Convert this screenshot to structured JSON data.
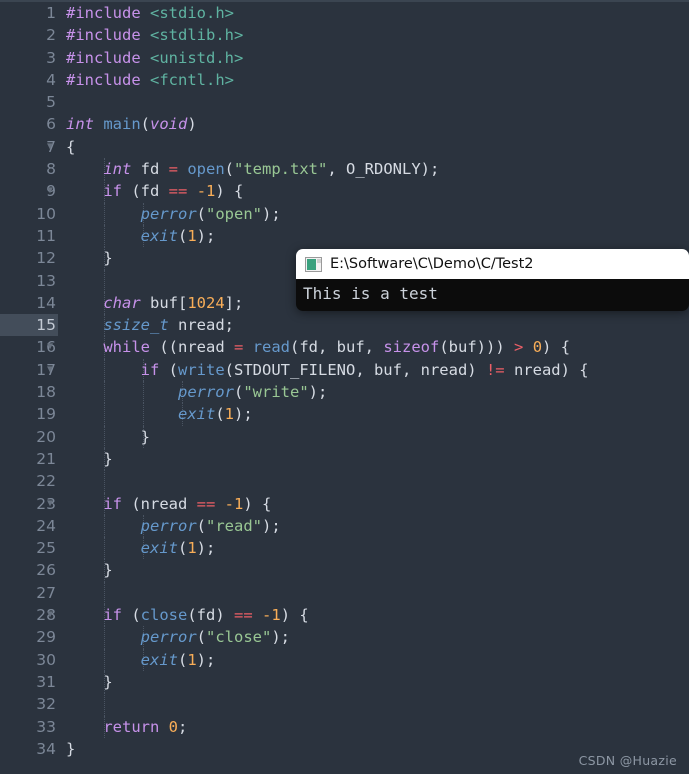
{
  "watermark": "CSDN @Huazie",
  "editor": {
    "language": "c",
    "current_line": 15,
    "colors": {
      "background": "#2b333e",
      "gutter_text": "#7c8797",
      "current_line_gutter": "#434d5a",
      "keyword": "#c792ea",
      "header": "#5fb3a1",
      "function": "#6699cc",
      "string": "#99c794",
      "number": "#f9ae58",
      "operator": "#ec5f67",
      "plain": "#d6dbe3"
    },
    "lines": [
      {
        "n": "1",
        "fold": false,
        "guides": [],
        "tokens": [
          {
            "t": "#include ",
            "c": "kw"
          },
          {
            "t": "<stdio.h>",
            "c": "hdr"
          }
        ]
      },
      {
        "n": "2",
        "fold": false,
        "guides": [],
        "tokens": [
          {
            "t": "#include ",
            "c": "kw"
          },
          {
            "t": "<stdlib.h>",
            "c": "hdr"
          }
        ]
      },
      {
        "n": "3",
        "fold": false,
        "guides": [],
        "tokens": [
          {
            "t": "#include ",
            "c": "kw"
          },
          {
            "t": "<unistd.h>",
            "c": "hdr"
          }
        ]
      },
      {
        "n": "4",
        "fold": false,
        "guides": [],
        "tokens": [
          {
            "t": "#include ",
            "c": "kw"
          },
          {
            "t": "<fcntl.h>",
            "c": "hdr"
          }
        ]
      },
      {
        "n": "5",
        "fold": false,
        "guides": [],
        "tokens": []
      },
      {
        "n": "6",
        "fold": false,
        "guides": [],
        "tokens": [
          {
            "t": "int",
            "c": "typ"
          },
          {
            "t": " ",
            "c": "pl"
          },
          {
            "t": "main",
            "c": "fn"
          },
          {
            "t": "(",
            "c": "pun"
          },
          {
            "t": "void",
            "c": "typ"
          },
          {
            "t": ")",
            "c": "pun"
          }
        ]
      },
      {
        "n": "7",
        "fold": true,
        "guides": [],
        "tokens": [
          {
            "t": "{",
            "c": "pun"
          }
        ]
      },
      {
        "n": "8",
        "fold": false,
        "guides": [
          "ig1"
        ],
        "tokens": [
          {
            "t": "    ",
            "c": "pl"
          },
          {
            "t": "int",
            "c": "typ"
          },
          {
            "t": " fd ",
            "c": "pl"
          },
          {
            "t": "=",
            "c": "op"
          },
          {
            "t": " ",
            "c": "pl"
          },
          {
            "t": "open",
            "c": "fn"
          },
          {
            "t": "(",
            "c": "pun"
          },
          {
            "t": "\"temp.txt\"",
            "c": "str"
          },
          {
            "t": ", O_RDONLY);",
            "c": "pun"
          }
        ]
      },
      {
        "n": "9",
        "fold": true,
        "guides": [
          "ig1"
        ],
        "tokens": [
          {
            "t": "    ",
            "c": "pl"
          },
          {
            "t": "if",
            "c": "kw"
          },
          {
            "t": " (fd ",
            "c": "pun"
          },
          {
            "t": "==",
            "c": "op"
          },
          {
            "t": " ",
            "c": "pl"
          },
          {
            "t": "-1",
            "c": "num2"
          },
          {
            "t": ") {",
            "c": "pun"
          }
        ]
      },
      {
        "n": "10",
        "fold": false,
        "guides": [
          "ig1",
          "ig2"
        ],
        "tokens": [
          {
            "t": "        ",
            "c": "pl"
          },
          {
            "t": "perror",
            "c": "fni"
          },
          {
            "t": "(",
            "c": "pun"
          },
          {
            "t": "\"open\"",
            "c": "str"
          },
          {
            "t": ");",
            "c": "pun"
          }
        ]
      },
      {
        "n": "11",
        "fold": false,
        "guides": [
          "ig1",
          "ig2"
        ],
        "tokens": [
          {
            "t": "        ",
            "c": "pl"
          },
          {
            "t": "exit",
            "c": "fni"
          },
          {
            "t": "(",
            "c": "pun"
          },
          {
            "t": "1",
            "c": "num2"
          },
          {
            "t": ");",
            "c": "pun"
          }
        ]
      },
      {
        "n": "12",
        "fold": false,
        "guides": [
          "ig1"
        ],
        "tokens": [
          {
            "t": "    }",
            "c": "pun"
          }
        ]
      },
      {
        "n": "13",
        "fold": false,
        "guides": [
          "ig1"
        ],
        "tokens": []
      },
      {
        "n": "14",
        "fold": false,
        "guides": [
          "ig1"
        ],
        "tokens": [
          {
            "t": "    ",
            "c": "pl"
          },
          {
            "t": "char",
            "c": "typ"
          },
          {
            "t": " buf[",
            "c": "pun"
          },
          {
            "t": "1024",
            "c": "num2"
          },
          {
            "t": "];",
            "c": "pun"
          }
        ]
      },
      {
        "n": "15",
        "fold": false,
        "guides": [
          "ig1"
        ],
        "tokens": [
          {
            "t": "    ",
            "c": "pl"
          },
          {
            "t": "ssize_t",
            "c": "typ2"
          },
          {
            "t": " nread;",
            "c": "pun"
          }
        ]
      },
      {
        "n": "16",
        "fold": true,
        "guides": [
          "ig1"
        ],
        "tokens": [
          {
            "t": "    ",
            "c": "pl"
          },
          {
            "t": "while",
            "c": "kw"
          },
          {
            "t": " ((nread ",
            "c": "pun"
          },
          {
            "t": "=",
            "c": "op"
          },
          {
            "t": " ",
            "c": "pl"
          },
          {
            "t": "read",
            "c": "fn"
          },
          {
            "t": "(fd, buf, ",
            "c": "pun"
          },
          {
            "t": "sizeof",
            "c": "kw"
          },
          {
            "t": "(buf))) ",
            "c": "pun"
          },
          {
            "t": ">",
            "c": "op"
          },
          {
            "t": " ",
            "c": "pl"
          },
          {
            "t": "0",
            "c": "num2"
          },
          {
            "t": ") {",
            "c": "pun"
          }
        ]
      },
      {
        "n": "17",
        "fold": true,
        "guides": [
          "ig1",
          "ig2"
        ],
        "tokens": [
          {
            "t": "        ",
            "c": "pl"
          },
          {
            "t": "if",
            "c": "kw"
          },
          {
            "t": " (",
            "c": "pun"
          },
          {
            "t": "write",
            "c": "fn"
          },
          {
            "t": "(STDOUT_FILENO, buf, nread) ",
            "c": "pun"
          },
          {
            "t": "!=",
            "c": "op"
          },
          {
            "t": " nread) {",
            "c": "pun"
          }
        ]
      },
      {
        "n": "18",
        "fold": false,
        "guides": [
          "ig1",
          "ig2",
          "ig3"
        ],
        "tokens": [
          {
            "t": "            ",
            "c": "pl"
          },
          {
            "t": "perror",
            "c": "fni"
          },
          {
            "t": "(",
            "c": "pun"
          },
          {
            "t": "\"write\"",
            "c": "str"
          },
          {
            "t": ");",
            "c": "pun"
          }
        ]
      },
      {
        "n": "19",
        "fold": false,
        "guides": [
          "ig1",
          "ig2",
          "ig3"
        ],
        "tokens": [
          {
            "t": "            ",
            "c": "pl"
          },
          {
            "t": "exit",
            "c": "fni"
          },
          {
            "t": "(",
            "c": "pun"
          },
          {
            "t": "1",
            "c": "num2"
          },
          {
            "t": ");",
            "c": "pun"
          }
        ]
      },
      {
        "n": "20",
        "fold": false,
        "guides": [
          "ig1",
          "ig2"
        ],
        "tokens": [
          {
            "t": "        }",
            "c": "pun"
          }
        ]
      },
      {
        "n": "21",
        "fold": false,
        "guides": [
          "ig1"
        ],
        "tokens": [
          {
            "t": "    }",
            "c": "pun"
          }
        ]
      },
      {
        "n": "22",
        "fold": false,
        "guides": [
          "ig1"
        ],
        "tokens": []
      },
      {
        "n": "23",
        "fold": true,
        "guides": [
          "ig1"
        ],
        "tokens": [
          {
            "t": "    ",
            "c": "pl"
          },
          {
            "t": "if",
            "c": "kw"
          },
          {
            "t": " (nread ",
            "c": "pun"
          },
          {
            "t": "==",
            "c": "op"
          },
          {
            "t": " ",
            "c": "pl"
          },
          {
            "t": "-1",
            "c": "num2"
          },
          {
            "t": ") {",
            "c": "pun"
          }
        ]
      },
      {
        "n": "24",
        "fold": false,
        "guides": [
          "ig1",
          "ig2"
        ],
        "tokens": [
          {
            "t": "        ",
            "c": "pl"
          },
          {
            "t": "perror",
            "c": "fni"
          },
          {
            "t": "(",
            "c": "pun"
          },
          {
            "t": "\"read\"",
            "c": "str"
          },
          {
            "t": ");",
            "c": "pun"
          }
        ]
      },
      {
        "n": "25",
        "fold": false,
        "guides": [
          "ig1",
          "ig2"
        ],
        "tokens": [
          {
            "t": "        ",
            "c": "pl"
          },
          {
            "t": "exit",
            "c": "fni"
          },
          {
            "t": "(",
            "c": "pun"
          },
          {
            "t": "1",
            "c": "num2"
          },
          {
            "t": ");",
            "c": "pun"
          }
        ]
      },
      {
        "n": "26",
        "fold": false,
        "guides": [
          "ig1"
        ],
        "tokens": [
          {
            "t": "    }",
            "c": "pun"
          }
        ]
      },
      {
        "n": "27",
        "fold": false,
        "guides": [
          "ig1"
        ],
        "tokens": []
      },
      {
        "n": "28",
        "fold": true,
        "guides": [
          "ig1"
        ],
        "tokens": [
          {
            "t": "    ",
            "c": "pl"
          },
          {
            "t": "if",
            "c": "kw"
          },
          {
            "t": " (",
            "c": "pun"
          },
          {
            "t": "close",
            "c": "fn"
          },
          {
            "t": "(fd) ",
            "c": "pun"
          },
          {
            "t": "==",
            "c": "op"
          },
          {
            "t": " ",
            "c": "pl"
          },
          {
            "t": "-1",
            "c": "num2"
          },
          {
            "t": ") {",
            "c": "pun"
          }
        ]
      },
      {
        "n": "29",
        "fold": false,
        "guides": [
          "ig1",
          "ig2"
        ],
        "tokens": [
          {
            "t": "        ",
            "c": "pl"
          },
          {
            "t": "perror",
            "c": "fni"
          },
          {
            "t": "(",
            "c": "pun"
          },
          {
            "t": "\"close\"",
            "c": "str"
          },
          {
            "t": ");",
            "c": "pun"
          }
        ]
      },
      {
        "n": "30",
        "fold": false,
        "guides": [
          "ig1",
          "ig2"
        ],
        "tokens": [
          {
            "t": "        ",
            "c": "pl"
          },
          {
            "t": "exit",
            "c": "fni"
          },
          {
            "t": "(",
            "c": "pun"
          },
          {
            "t": "1",
            "c": "num2"
          },
          {
            "t": ");",
            "c": "pun"
          }
        ]
      },
      {
        "n": "31",
        "fold": false,
        "guides": [
          "ig1"
        ],
        "tokens": [
          {
            "t": "    }",
            "c": "pun"
          }
        ]
      },
      {
        "n": "32",
        "fold": false,
        "guides": [
          "ig1"
        ],
        "tokens": []
      },
      {
        "n": "33",
        "fold": false,
        "guides": [
          "ig1"
        ],
        "tokens": [
          {
            "t": "    ",
            "c": "pl"
          },
          {
            "t": "return",
            "c": "kw"
          },
          {
            "t": " ",
            "c": "pl"
          },
          {
            "t": "0",
            "c": "num2"
          },
          {
            "t": ";",
            "c": "pun"
          }
        ]
      },
      {
        "n": "34",
        "fold": false,
        "guides": [],
        "tokens": [
          {
            "t": "}",
            "c": "pun"
          }
        ]
      }
    ],
    "fold_glyph": "▼"
  },
  "console": {
    "icon": "console-window-icon",
    "title": "E:\\Software\\C\\Demo\\C/Test2",
    "output_lines": [
      "This is a test"
    ],
    "titlebar_bg": "#ffffff",
    "body_bg": "#0c0c0c"
  }
}
